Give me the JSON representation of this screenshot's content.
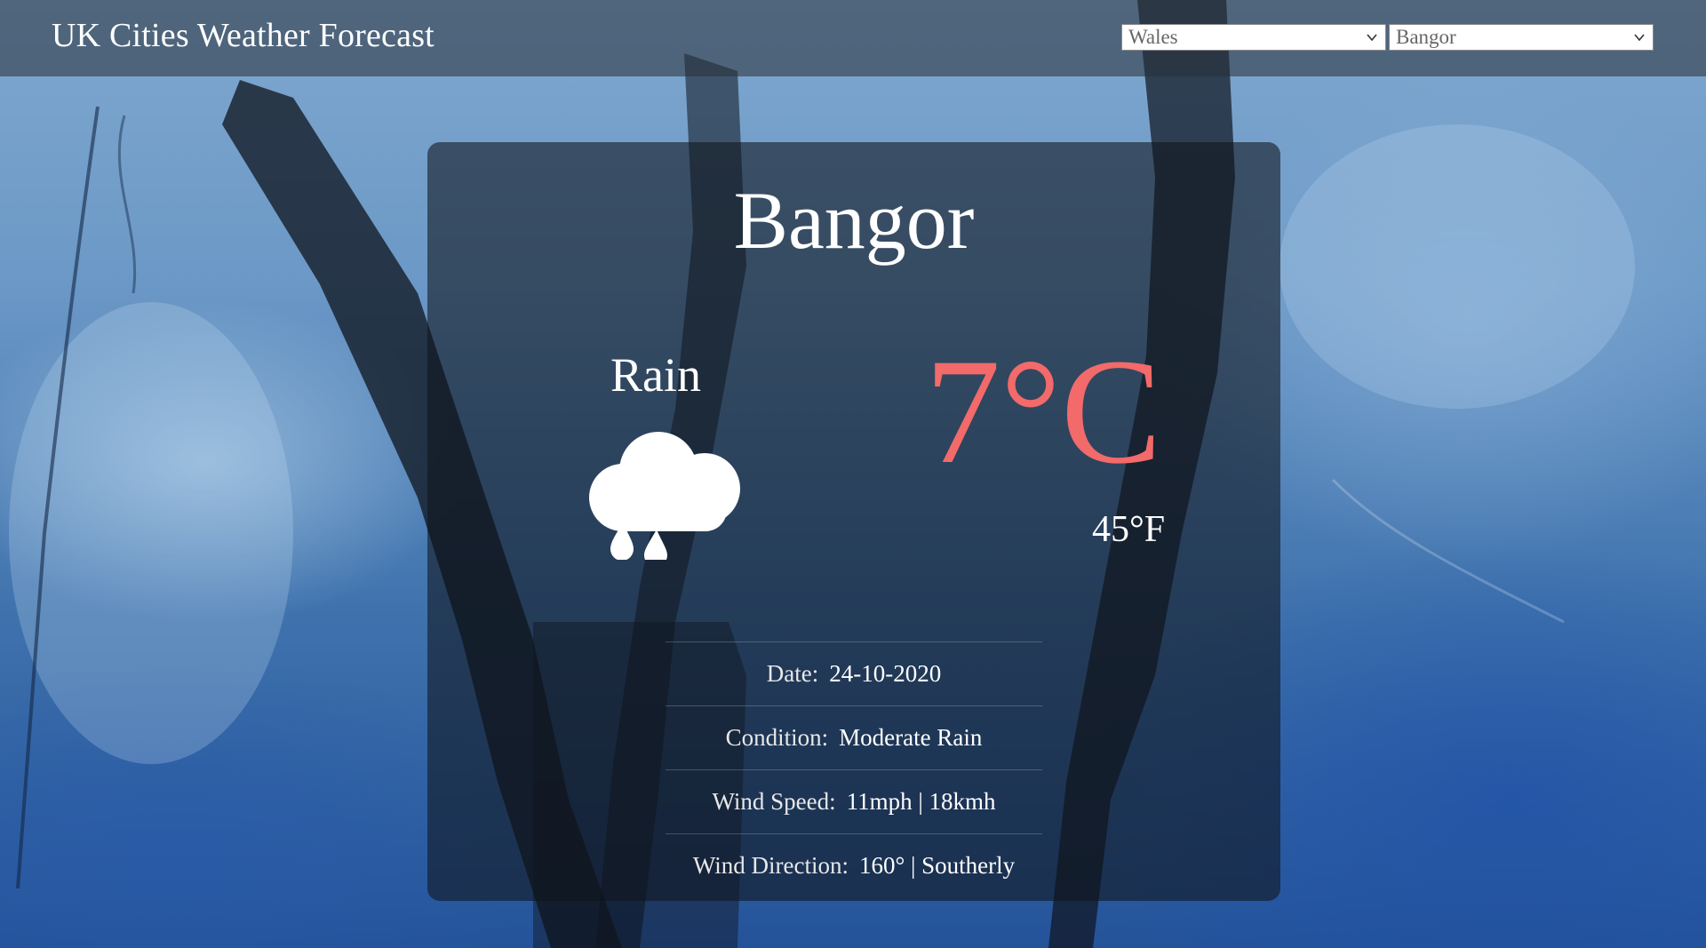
{
  "header": {
    "title": "UK Cities Weather Forecast",
    "region_select": {
      "value": "Wales"
    },
    "city_select": {
      "value": "Bangor"
    }
  },
  "card": {
    "city": "Bangor",
    "condition_short": "Rain",
    "icon": "rain-cloud-icon",
    "temp_c": "7°C",
    "temp_f": "45°F",
    "details": [
      {
        "label": "Date:",
        "value": "24-10-2020"
      },
      {
        "label": "Condition:",
        "value": "Moderate Rain"
      },
      {
        "label": "Wind Speed:",
        "value": "11mph | 18kmh"
      },
      {
        "label": "Wind Direction:",
        "value": "160° | Southerly"
      }
    ]
  },
  "colors": {
    "accent_temperature": "#f26a6a",
    "card_background": "rgba(16,20,28,0.58)",
    "header_background": "rgba(40,48,56,0.55)"
  }
}
